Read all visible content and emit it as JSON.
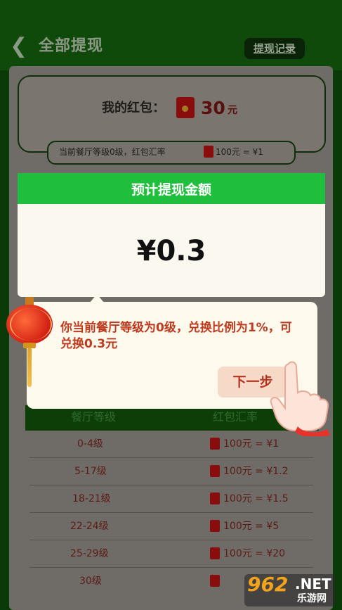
{
  "header": {
    "title": "全部提现",
    "record_btn": "提现记录",
    "back_icon": "chevron-left-icon"
  },
  "wallet": {
    "label": "我的红包：",
    "amount": "30",
    "unit": "元",
    "rate_text": "当前餐厅等级0级，红包汇率",
    "rate_value": "100元 = ¥1"
  },
  "estimate": {
    "header": "预计提现金额",
    "amount": "¥0.3"
  },
  "tip": {
    "text": "你当前餐厅等级为0级，兑换比例为1%，可兑换0.3元",
    "next_btn": "下一步"
  },
  "table": {
    "headers": [
      "餐厅等级",
      "红包汇率"
    ],
    "rows": [
      {
        "level": "0-4级",
        "rate": "100元 = ¥1"
      },
      {
        "level": "5-17级",
        "rate": "100元 = ¥1.2"
      },
      {
        "level": "18-21级",
        "rate": "100元 = ¥1.5"
      },
      {
        "level": "22-24级",
        "rate": "100元 = ¥5"
      },
      {
        "level": "25-29级",
        "rate": "100元 = ¥20"
      },
      {
        "level": "30级",
        "rate": ""
      }
    ]
  },
  "watermark": {
    "logo": "962",
    "net": ".NET",
    "sub": "乐游网"
  },
  "colors": {
    "accent_green": "#1fbe3d",
    "tip_red": "#bf3b1f",
    "envelope_red": "#8a0d0d"
  }
}
